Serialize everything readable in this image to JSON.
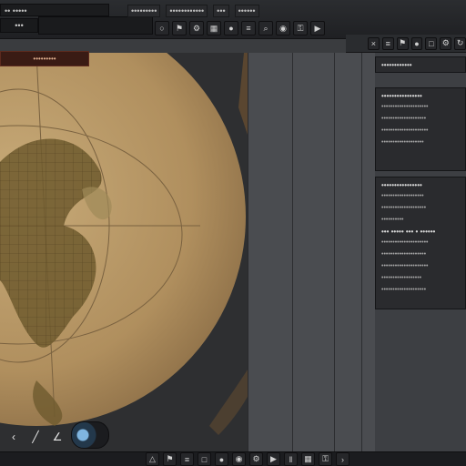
{
  "topbar": {
    "window_title": "•• •••••",
    "small_box": "•••",
    "menu": [
      "•••••••••",
      "••••••••••••",
      "•••",
      "••••••"
    ],
    "tool_icons": [
      "circle-icon",
      "flag-icon",
      "gear-icon",
      "grid-icon",
      "pin-icon",
      "layers-icon",
      "search-icon",
      "eye-icon",
      "lock-icon",
      "play-icon"
    ],
    "tool_glyphs": [
      "○",
      "⚑",
      "⚙",
      "▦",
      "●",
      "≡",
      "⌕",
      "◉",
      "⚿",
      "▶"
    ]
  },
  "map_tab": {
    "label": "•••••••••"
  },
  "rightbar": {
    "icons": [
      "close-icon",
      "layers-icon",
      "flag-icon",
      "pin-icon",
      "square-icon",
      "settings-icon",
      "refresh-icon"
    ],
    "glyphs": [
      "×",
      "≡",
      "⚑",
      "●",
      "□",
      "⚙",
      "↻"
    ]
  },
  "cards": [
    {
      "title": "••••••••••••••••",
      "lines": [
        "•••••••••••••••••••••",
        "••••••••••••••••••••",
        "•••••••••••••••••••••",
        "•••••••••••••••••••"
      ]
    },
    {
      "title": "••••••••••••••••",
      "lines": [
        "•••••••••••••••••••",
        "••••••••••••••••••••",
        "••••••••••"
      ],
      "subtitle": "••• ••••• ••• • ••••••",
      "lines2": [
        "•••••••••••••••••••••",
        "••••••••••••••••••••",
        "•••••••••••••••••••••",
        "••••••••••••••••••",
        "••••••••••••••••••••"
      ]
    }
  ],
  "bottombar": {
    "icons": [
      "triangle-up-icon",
      "flag-icon",
      "layers-icon",
      "square-icon",
      "pin-icon",
      "eye-icon",
      "gear-icon",
      "play-icon",
      "bar-icon",
      "grid-icon",
      "lock-icon",
      "chevron-right-icon"
    ],
    "glyphs": [
      "△",
      "⚑",
      "≡",
      "□",
      "●",
      "◉",
      "⚙",
      "▶",
      "‖",
      "▦",
      "⚿",
      "›"
    ]
  },
  "nav": {
    "icons": [
      "chevron-left-icon",
      "slash-icon",
      "angle-icon"
    ],
    "glyphs": [
      "‹",
      "╱",
      "∠"
    ]
  },
  "colors": {
    "parchment": "#b89a6a",
    "parchment_dark": "#8f7650",
    "land": "#6e5a2e",
    "panel": "#2a2b2e",
    "accent_red": "#5c2a1e",
    "compass_blue": "#7fb5e0"
  }
}
